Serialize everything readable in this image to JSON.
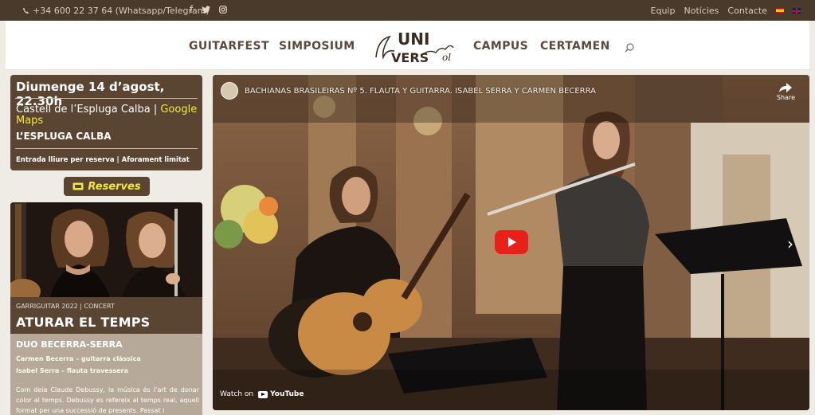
{
  "topbar": {
    "phone": "+34 600 22 37 64 (Whatsapp/Telegram)",
    "social_icons": [
      "facebook-icon",
      "twitter-icon",
      "instagram-icon"
    ],
    "links": [
      "Equip",
      "Notícies",
      "Contacte"
    ],
    "languages": [
      "es",
      "en"
    ]
  },
  "header": {
    "nav_left": [
      "GUITARFEST",
      "SIMPOSIUM"
    ],
    "logo_text": {
      "line1": "UNI",
      "line2": "VERS",
      "script": "Universo"
    },
    "nav_right": [
      "CAMPUS",
      "CERTAMEN"
    ]
  },
  "event": {
    "date": "Diumenge 14 d’agost, 22.30h",
    "venue": "Castell de l’Espluga Calba | ",
    "map_link": "Google Maps",
    "town": "L’ESPLUGA CALBA",
    "entry": "Entrada lliure per reserva | Aforament limitat"
  },
  "reserves_label": "Reserves",
  "concert": {
    "meta": "GARRIGUITAR 2022 | CONCERT",
    "title": "ATURAR EL TEMPS",
    "artists": "DUO BECERRA-SERRA",
    "role1": "Carmen Becerra – guitarra clàssica",
    "role2": "Isabel Serra – flauta travessera",
    "description": "Com deia Claude Debussy, la música és l’art de donar color al temps. Debussy es refereix al temps real, aquell format per una successió de presents. Passat i"
  },
  "video": {
    "title": "BACHIANAS BRASILEIRAS Nº 5. FLAUTA Y GUITARRA. ISABEL SERRA Y CARMEN BECERRA",
    "share_label": "Share",
    "watch_on": "Watch on",
    "youtube_label": "YouTube"
  },
  "colors": {
    "brand_brown": "#5a4533",
    "topbar": "#4a3a2b",
    "link_yellow": "#f4e93a",
    "play_red": "#e8201a"
  }
}
